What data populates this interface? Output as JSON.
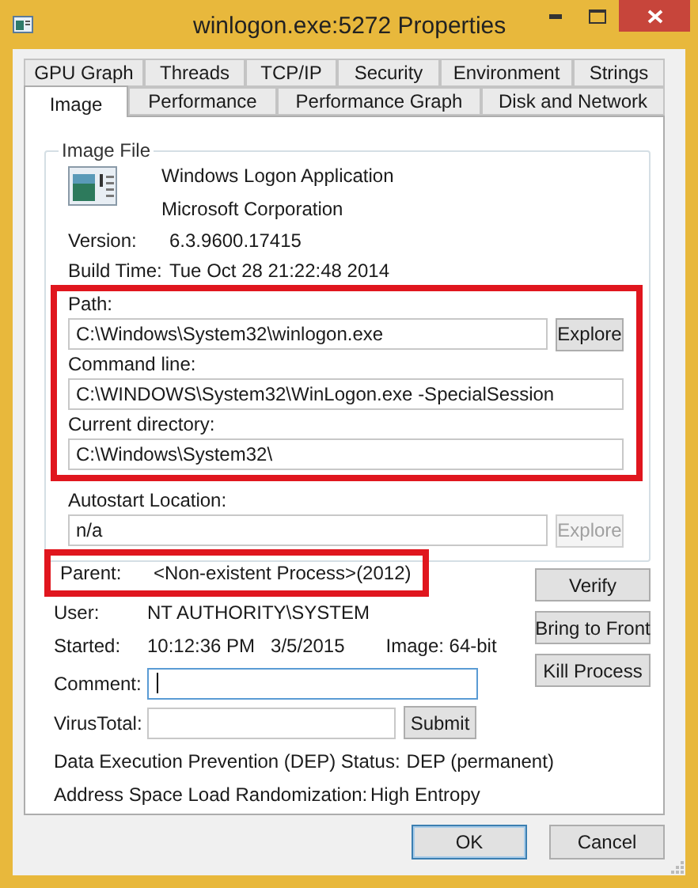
{
  "window": {
    "title": "winlogon.exe:5272 Properties"
  },
  "tab_rows": [
    {
      "tabs": [
        {
          "label": "GPU Graph",
          "selected": false
        },
        {
          "label": "Threads",
          "selected": false
        },
        {
          "label": "TCP/IP",
          "selected": false
        },
        {
          "label": "Security",
          "selected": false
        },
        {
          "label": "Environment",
          "selected": false
        },
        {
          "label": "Strings",
          "selected": false
        }
      ]
    },
    {
      "tabs": [
        {
          "label": "Image",
          "selected": true
        },
        {
          "label": "Performance",
          "selected": false
        },
        {
          "label": "Performance Graph",
          "selected": false
        },
        {
          "label": "Disk and Network",
          "selected": false
        }
      ]
    }
  ],
  "image_file": {
    "title": "Image File",
    "description": "Windows Logon Application",
    "company": "Microsoft Corporation",
    "info": [
      {
        "label": "Version:",
        "value": "6.3.9600.17415"
      },
      {
        "label": "Build Time:",
        "value": "Tue Oct 28 21:22:48 2014"
      }
    ],
    "sections": [
      {
        "highlighted": true,
        "fields": [
          {
            "label": "Path:",
            "value": "C:\\Windows\\System32\\winlogon.exe",
            "button": {
              "label": "Explore",
              "disabled": false
            }
          },
          {
            "label": "Command line:",
            "value": "C:\\WINDOWS\\System32\\WinLogon.exe -SpecialSession"
          },
          {
            "label": "Current directory:",
            "value": "C:\\Windows\\System32\\"
          }
        ]
      },
      {
        "highlighted": false,
        "fields": [
          {
            "label": "Autostart Location:",
            "value": "n/a",
            "button": {
              "label": "Explore",
              "disabled": true
            }
          }
        ]
      }
    ]
  },
  "parent": {
    "label": "Parent:",
    "value": "<Non-existent Process>(2012)",
    "highlighted": true
  },
  "user": {
    "label": "User:",
    "value": "NT AUTHORITY\\SYSTEM"
  },
  "started": {
    "label": "Started:",
    "time": "10:12:36 PM",
    "date": "3/5/2015",
    "image": "Image: 64-bit"
  },
  "comment": {
    "label": "Comment:",
    "focused": true
  },
  "virustotal": {
    "label": "VirusTotal:",
    "button": "Submit"
  },
  "dep": {
    "label": "Data Execution Prevention (DEP) Status:",
    "value": "DEP (permanent)"
  },
  "aslr": {
    "label": "Address Space Load Randomization:",
    "value": "High Entropy"
  },
  "side_buttons": [
    "Verify",
    "Bring to Front",
    "Kill Process"
  ],
  "footer_buttons": [
    {
      "label": "OK",
      "default": true
    },
    {
      "label": "Cancel",
      "default": false
    }
  ]
}
